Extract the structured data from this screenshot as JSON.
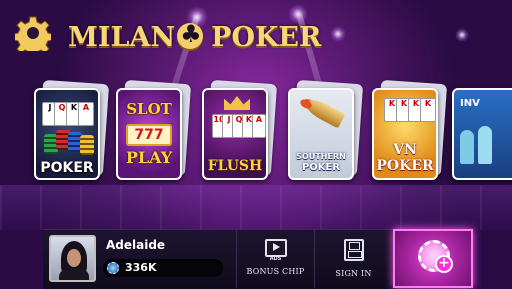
{
  "header": {
    "logo_left": "MILAN",
    "logo_right": "POKER",
    "settings_icon": "gear-icon"
  },
  "games": [
    {
      "label": "POKER",
      "cards": [
        "J",
        "Q",
        "K",
        "A"
      ]
    },
    {
      "label_top": "SLOT",
      "label_mid": "777",
      "label_bottom": "PLAY"
    },
    {
      "label": "FLUSH",
      "cards": [
        "10",
        "J",
        "Q",
        "K",
        "A"
      ]
    },
    {
      "label_top": "SOUTHERN",
      "label_bottom": "POKER"
    },
    {
      "label_top": "VN",
      "label_bottom": "POKER",
      "cards": [
        "K",
        "K",
        "K",
        "K"
      ]
    },
    {
      "label": "INV"
    }
  ],
  "player": {
    "name": "Adelaide",
    "balance": "336K"
  },
  "actions": {
    "bonus_chip_label": "BONUS CHIP",
    "ads_text": "ADS",
    "sign_in_label": "SIGN IN"
  },
  "colors": {
    "logo_gold": "#f7d67a",
    "shop_magenta": "#e04ad8",
    "bar_dark": "#0f0b1c"
  }
}
